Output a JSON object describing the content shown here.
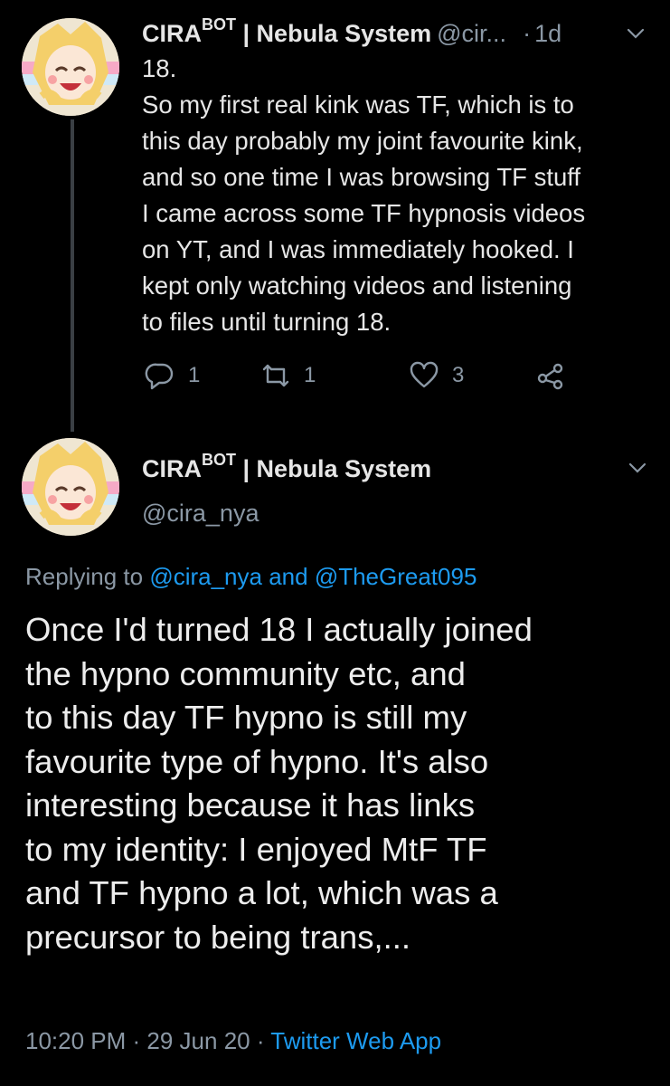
{
  "tweet1": {
    "name": "CIRA",
    "name_sup": "BOT",
    "name_suffix": " | Nebula System",
    "handle": "@cir...",
    "separator": "·",
    "time": "1d",
    "text": "18.\nSo my first real kink was TF, which is to\nthis day probably my joint favourite kink,\nand so one time I was browsing TF stuff\nI came across some TF hypnosis videos\non YT, and I was immediately hooked. I\nkept only watching videos and listening\nto files until turning 18.",
    "actions": {
      "replies": "1",
      "retweets": "1",
      "likes": "3"
    }
  },
  "tweet2": {
    "name": "CIRA",
    "name_sup": "BOT",
    "name_suffix": " | Nebula System",
    "handle": "@cira_nya",
    "replying_prefix": "Replying to ",
    "replying_user1": "@cira_nya",
    "replying_and": " and ",
    "replying_user2": "@TheGreat095",
    "text_lines": [
      "Once I'd turned 18 I actually joined",
      "the hypno community etc, and",
      "to this day TF hypno is still my",
      "favourite type of hypno. It's also",
      "interesting because it has links",
      "to my identity: I enjoyed MtF TF",
      "and TF hypno a lot, which was a",
      "precursor to being trans,..."
    ],
    "time": "10:20 PM",
    "sep1": " · ",
    "date": "29 Jun 20",
    "sep2": " · ",
    "source": "Twitter Web App"
  },
  "colors": {
    "background": "#000000",
    "text": "#e6e6e6",
    "muted": "#8b98a5",
    "link": "#1d9bf0"
  }
}
